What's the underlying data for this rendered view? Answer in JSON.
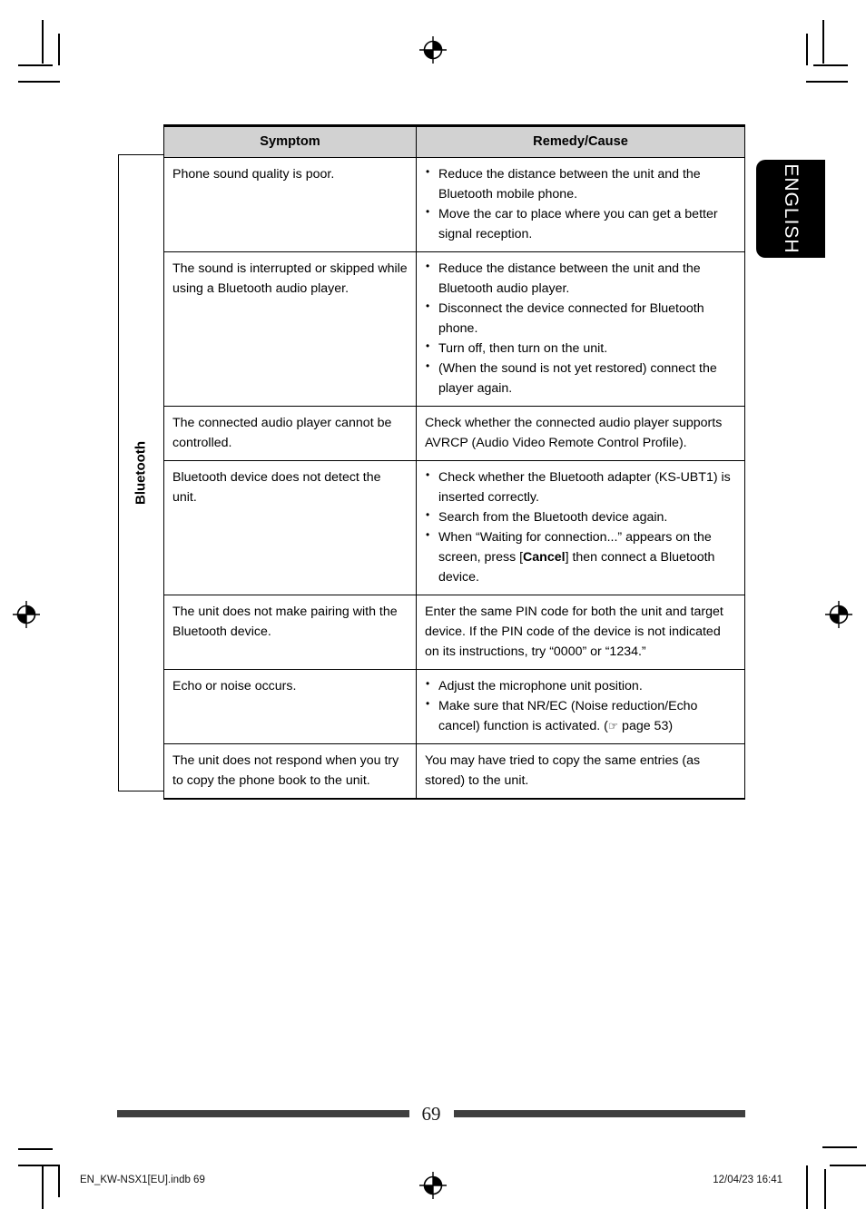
{
  "page": {
    "number": "69",
    "language_tab": "ENGLISH",
    "category_label": "Bluetooth"
  },
  "table": {
    "headers": {
      "symptom": "Symptom",
      "remedy": "Remedy/Cause"
    },
    "rows": [
      {
        "symptom": "Phone sound quality is poor.",
        "remedy_type": "bullets",
        "remedy_items": [
          "Reduce the distance between the unit and the Bluetooth mobile phone.",
          "Move the car to place where you can get a better signal reception."
        ]
      },
      {
        "symptom": "The sound is interrupted or skipped while using a Bluetooth audio player.",
        "remedy_type": "bullets",
        "remedy_items": [
          "Reduce the distance between the unit and the Bluetooth audio player.",
          "Disconnect the device connected for Bluetooth phone.",
          "Turn off, then turn on the unit.",
          "(When the sound is not yet restored) connect the player again."
        ]
      },
      {
        "symptom": "The connected audio player cannot be controlled.",
        "remedy_type": "text",
        "remedy_text": "Check whether the connected audio player supports AVRCP (Audio Video Remote Control Profile)."
      },
      {
        "symptom": "Bluetooth device does not detect the unit.",
        "remedy_type": "bullets",
        "remedy_items": [
          "Check whether the Bluetooth adapter (KS-UBT1) is inserted correctly.",
          "Search from the Bluetooth device again.",
          "When “Waiting for connection...” appears on the screen, press [Cancel] then connect a Bluetooth device."
        ],
        "remedy_bold_fragment": "Cancel"
      },
      {
        "symptom": "The unit does not make pairing with the Bluetooth device.",
        "remedy_type": "text",
        "remedy_text": "Enter the same PIN code for both the unit and target device. If the PIN code of the device is not indicated on its instructions, try “0000” or “1234.”"
      },
      {
        "symptom": "Echo or noise occurs.",
        "remedy_type": "bullets",
        "remedy_items": [
          "Adjust the microphone unit position.",
          "Make sure that NR/EC (Noise reduction/Echo cancel) function is activated. (☞ page 53)"
        ],
        "remedy_reference": "page 53",
        "remedy_reference_icon": "pointing-hand-icon"
      },
      {
        "symptom": "The unit does not respond when you try to copy the phone book to the unit.",
        "remedy_type": "text",
        "remedy_text": "You may have tried to copy the same entries (as stored) to the unit."
      }
    ]
  },
  "print_slug": {
    "filename": "EN_KW-NSX1[EU].indb   69",
    "timestamp": "12/04/23   16:41"
  },
  "colors": {
    "header_fill": "#d2d2d2",
    "rule": "#000000",
    "footer_bar": "#3f3f3f",
    "tab_fill": "#000000",
    "tab_text": "#ffffff"
  }
}
